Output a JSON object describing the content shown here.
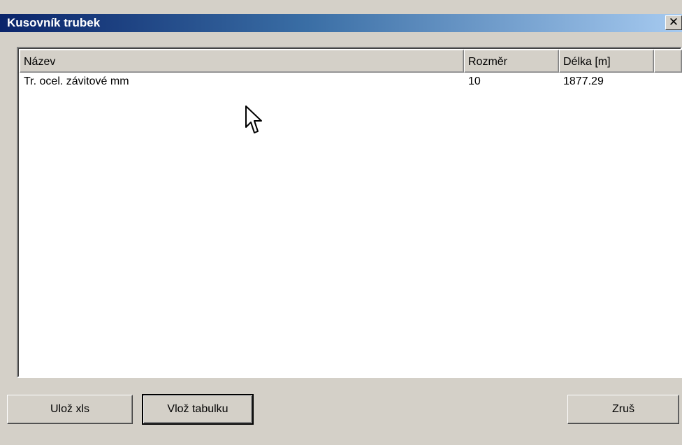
{
  "window": {
    "title": "Kusovník trubek",
    "close_glyph": "✕"
  },
  "table": {
    "columns": [
      "Název",
      "Rozměr",
      "Délka [m]",
      ""
    ],
    "rows": [
      {
        "nazev": "Tr. ocel. závitové mm",
        "rozmer": "10",
        "delka": "1877.29"
      }
    ]
  },
  "buttons": {
    "save_xls": "Ulož xls",
    "insert_table": "Vlož tabulku",
    "cancel": "Zruš"
  },
  "cursor": {
    "icon": "arrow-cursor-icon"
  }
}
